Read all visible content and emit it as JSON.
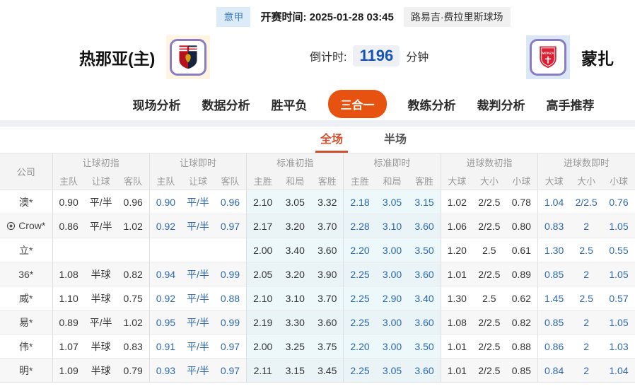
{
  "header": {
    "league": "意甲",
    "kickoff_label": "开赛时间:",
    "kickoff_time": "2025-01-28 03:45",
    "venue": "路易吉·费拉里斯球场"
  },
  "teams": {
    "home": {
      "name": "热那亚(主)",
      "logo": "genoa-crest-icon"
    },
    "away": {
      "name": "蒙扎",
      "logo": "monza-crest-icon"
    },
    "countdown": {
      "label": "倒计时:",
      "value": "1196",
      "unit": "分钟"
    }
  },
  "nav": {
    "tabs": [
      {
        "label": "现场分析",
        "active": false
      },
      {
        "label": "数据分析",
        "active": false
      },
      {
        "label": "胜平负",
        "active": false
      },
      {
        "label": "三合一",
        "active": true
      },
      {
        "label": "教练分析",
        "active": false
      },
      {
        "label": "裁判分析",
        "active": false
      },
      {
        "label": "高手推荐",
        "active": false
      }
    ]
  },
  "subtabs": [
    {
      "label": "全场",
      "active": true
    },
    {
      "label": "半场",
      "active": false
    }
  ],
  "table": {
    "company_header": "公司",
    "groups": [
      {
        "label": "让球初指",
        "cols": [
          "主队",
          "让球",
          "客队"
        ],
        "live": false,
        "highlight": false
      },
      {
        "label": "让球即时",
        "cols": [
          "主队",
          "让球",
          "客队"
        ],
        "live": true,
        "highlight": false
      },
      {
        "label": "标准初指",
        "cols": [
          "主胜",
          "和局",
          "客胜"
        ],
        "live": false,
        "highlight": true
      },
      {
        "label": "标准即时",
        "cols": [
          "主胜",
          "和局",
          "客胜"
        ],
        "live": true,
        "highlight": true
      },
      {
        "label": "进球数初指",
        "cols": [
          "大球",
          "大小",
          "小球"
        ],
        "live": false,
        "highlight": false
      },
      {
        "label": "进球数即时",
        "cols": [
          "大球",
          "大小",
          "小球"
        ],
        "live": true,
        "highlight": false
      }
    ],
    "rows": [
      {
        "company": "澳*",
        "icon": "",
        "values": [
          [
            "0.90",
            "平/半",
            "0.96"
          ],
          [
            "0.90",
            "平/半",
            "0.96"
          ],
          [
            "2.10",
            "3.05",
            "3.32"
          ],
          [
            "2.18",
            "3.05",
            "3.15"
          ],
          [
            "1.02",
            "2/2.5",
            "0.78"
          ],
          [
            "1.04",
            "2/2.5",
            "0.76"
          ]
        ]
      },
      {
        "company": "Crow*",
        "icon": "football-target-icon",
        "values": [
          [
            "0.86",
            "平/半",
            "1.02"
          ],
          [
            "0.92",
            "平/半",
            "0.97"
          ],
          [
            "2.17",
            "3.20",
            "3.70"
          ],
          [
            "2.28",
            "3.10",
            "3.60"
          ],
          [
            "1.06",
            "2/2.5",
            "0.80"
          ],
          [
            "0.83",
            "2",
            "1.05"
          ]
        ]
      },
      {
        "company": "立*",
        "icon": "",
        "values": [
          [
            "",
            "",
            ""
          ],
          [
            "",
            "",
            ""
          ],
          [
            "2.00",
            "3.40",
            "3.60"
          ],
          [
            "2.20",
            "3.00",
            "3.50"
          ],
          [
            "1.20",
            "2.5",
            "0.61"
          ],
          [
            "1.30",
            "2.5",
            "0.55"
          ]
        ]
      },
      {
        "company": "36*",
        "icon": "",
        "values": [
          [
            "1.08",
            "半球",
            "0.82"
          ],
          [
            "0.94",
            "平/半",
            "0.99"
          ],
          [
            "2.05",
            "3.20",
            "3.90"
          ],
          [
            "2.25",
            "3.00",
            "3.60"
          ],
          [
            "1.01",
            "2/2.5",
            "0.89"
          ],
          [
            "0.85",
            "2",
            "1.05"
          ]
        ]
      },
      {
        "company": "威*",
        "icon": "",
        "values": [
          [
            "1.10",
            "半球",
            "0.75"
          ],
          [
            "0.92",
            "平/半",
            "0.88"
          ],
          [
            "2.10",
            "3.10",
            "3.70"
          ],
          [
            "2.25",
            "2.90",
            "3.40"
          ],
          [
            "1.30",
            "2.5",
            "0.62"
          ],
          [
            "1.45",
            "2.5",
            "0.57"
          ]
        ]
      },
      {
        "company": "易*",
        "icon": "",
        "values": [
          [
            "0.89",
            "平/半",
            "1.02"
          ],
          [
            "0.95",
            "平/半",
            "0.99"
          ],
          [
            "2.19",
            "3.30",
            "3.60"
          ],
          [
            "2.25",
            "3.00",
            "3.60"
          ],
          [
            "1.08",
            "2/2.5",
            "0.82"
          ],
          [
            "0.85",
            "2",
            "1.05"
          ]
        ]
      },
      {
        "company": "伟*",
        "icon": "",
        "values": [
          [
            "1.07",
            "半球",
            "0.83"
          ],
          [
            "0.91",
            "平/半",
            "0.97"
          ],
          [
            "2.00",
            "3.25",
            "3.75"
          ],
          [
            "2.20",
            "3.00",
            "3.50"
          ],
          [
            "1.01",
            "2/2.5",
            "0.88"
          ],
          [
            "0.86",
            "2",
            "1.03"
          ]
        ]
      },
      {
        "company": "明*",
        "icon": "",
        "values": [
          [
            "1.09",
            "半球",
            "0.79"
          ],
          [
            "0.93",
            "平/半",
            "0.97"
          ],
          [
            "2.11",
            "3.15",
            "3.45"
          ],
          [
            "2.25",
            "3.05",
            "3.60"
          ],
          [
            "1.01",
            "2/2.5",
            "0.85"
          ],
          [
            "0.84",
            "2",
            "1.04"
          ]
        ]
      }
    ]
  },
  "colors": {
    "accent_orange": "#e85210",
    "subtab_active": "#cd5030",
    "live_odds_blue": "#2c68b0",
    "standard_highlight": "#ecf8f9",
    "league_badge_bg": "#dcebf8",
    "league_badge_text": "#4a80c1",
    "countdown_blue": "#1553b5"
  }
}
